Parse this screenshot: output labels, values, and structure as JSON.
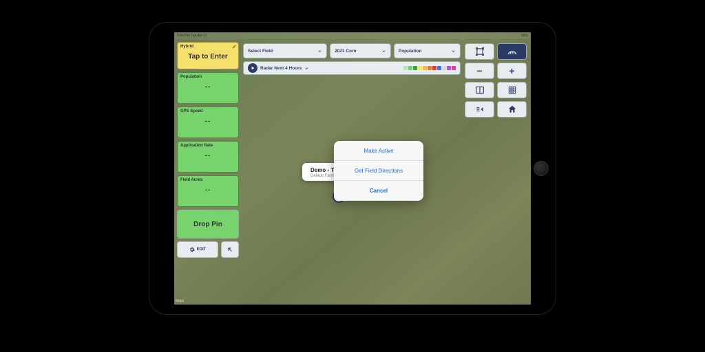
{
  "statusbar": {
    "left": "6:49 PM  Tue Apr 27",
    "right": "56%"
  },
  "sidebar": {
    "hybrid": {
      "label": "Hybrid",
      "value": "Tap to Enter"
    },
    "population": {
      "label": "Population",
      "value": "--"
    },
    "gps": {
      "label": "GPS Speed",
      "value": "--"
    },
    "rate": {
      "label": "Application Rate",
      "value": "--"
    },
    "acres": {
      "label": "Field Acres",
      "value": "--"
    },
    "drop_pin": "Drop Pin",
    "edit": "EDIT"
  },
  "top": {
    "field": "Select Field",
    "season": "2021 Corn",
    "layer": "Population"
  },
  "radar": {
    "label": "Radar Next 4 Hours",
    "legend_colors": [
      "#b8e3b6",
      "#6fcf6a",
      "#3aa33a",
      "#f6e94a",
      "#f5b940",
      "#ef7a2a",
      "#e03a2a",
      "#4a6de0",
      "#d9d9d9",
      "#b84ad9",
      "#e03a8a"
    ]
  },
  "tools": {
    "fullscreen": "fullscreen-icon",
    "boundary": "field-boundary-icon",
    "zoom_out": "−",
    "zoom_in": "+",
    "split": "split-view-icon",
    "grid": "grid-icon",
    "layers": "layers-toggle-icon",
    "home": "home-icon"
  },
  "callout": {
    "title": "Demo - Te",
    "subtitle": "Default Farm"
  },
  "popup": {
    "make_active": "Make Active",
    "directions": "Get Field Directions",
    "cancel": "Cancel"
  },
  "map": {
    "attribution": "Maps"
  }
}
